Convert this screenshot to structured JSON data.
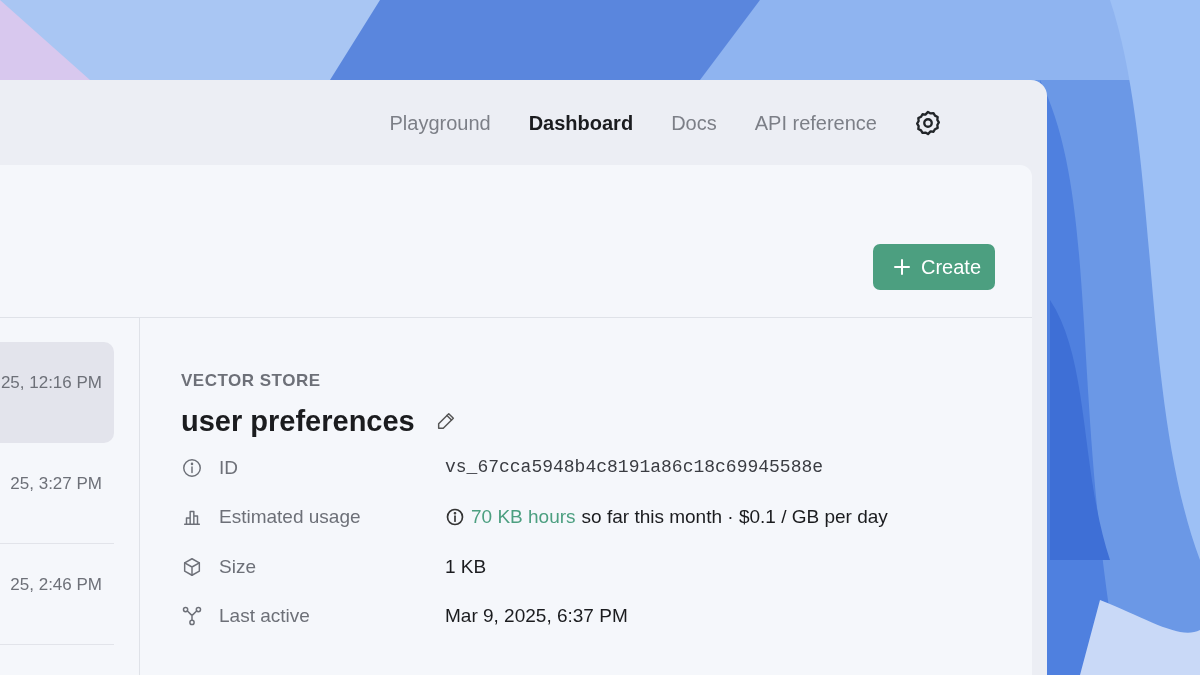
{
  "nav": {
    "links": [
      {
        "label": "Playground",
        "selected": false
      },
      {
        "label": "Dashboard",
        "selected": true
      },
      {
        "label": "Docs",
        "selected": false
      },
      {
        "label": "API reference",
        "selected": false
      }
    ]
  },
  "toolbar": {
    "create_button": {
      "label": "Create"
    }
  },
  "list": {
    "items": [
      {
        "date": "25, 12:16 PM",
        "selected": true
      },
      {
        "date": "25, 3:27 PM",
        "selected": false
      },
      {
        "date": "25, 2:46 PM",
        "selected": false
      }
    ]
  },
  "detail": {
    "eyebrow": "VECTOR STORE",
    "title": "user preferences",
    "rows": [
      {
        "kind": "id",
        "label": "ID",
        "value": "vs_67cca5948b4c8191a86c18c69945588e"
      },
      {
        "kind": "usage",
        "label": "Estimated usage",
        "link": "70 KB hours",
        "value": "so far this month · $0.1 / GB per day"
      },
      {
        "kind": "size",
        "label": "Size",
        "value": "1 KB"
      },
      {
        "kind": "activity",
        "label": "Last active",
        "value": "Mar 9, 2025, 6:37 PM"
      }
    ]
  }
}
